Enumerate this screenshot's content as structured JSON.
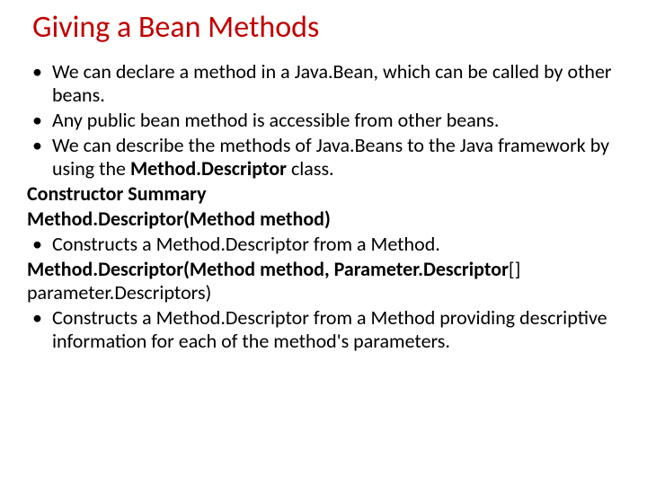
{
  "title": "Giving a Bean Methods",
  "b1": "We can declare a method in a Java.Bean, which can be called by other beans.",
  "b2": "Any public  bean method is accessible from other beans.",
  "b3a": "We can describe the methods of Java.Beans to the Java framework by using the ",
  "b3b": "Method.Descriptor",
  "b3c": " class.",
  "cs": "Constructor Summary",
  "sig1": " Method.Descriptor(Method  method)",
  "b4": "Constructs a Method.Descriptor from a Method.",
  "sig2a": "Method.Descriptor(Method  method, Parameter.Descriptor",
  "sig2b": "[] parameter.Descriptors)",
  "b5": "Constructs a Method.Descriptor from a Method providing descriptive information for each of the method's parameters."
}
